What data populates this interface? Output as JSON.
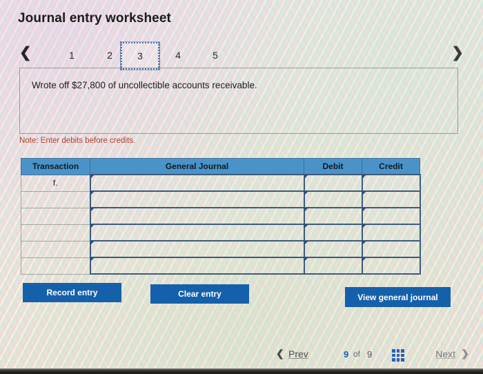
{
  "page_title": "Journal entry worksheet",
  "tabs": {
    "prev_icon": "chevron-left-icon",
    "next_icon": "chevron-right-icon",
    "items": [
      {
        "label": "1",
        "selected": false
      },
      {
        "label": "2",
        "selected": false
      },
      {
        "label": "3",
        "selected": true
      },
      {
        "label": "4",
        "selected": false
      },
      {
        "label": "5",
        "selected": false
      }
    ]
  },
  "description": "Wrote off $27,800 of uncollectible accounts receivable.",
  "note": "Note: Enter debits before credits.",
  "table": {
    "headers": {
      "transaction": "Transaction",
      "general_journal": "General Journal",
      "debit": "Debit",
      "credit": "Credit"
    },
    "rows": [
      {
        "transaction": "f.",
        "general_journal": "",
        "debit": "",
        "credit": ""
      },
      {
        "transaction": "",
        "general_journal": "",
        "debit": "",
        "credit": ""
      },
      {
        "transaction": "",
        "general_journal": "",
        "debit": "",
        "credit": ""
      },
      {
        "transaction": "",
        "general_journal": "",
        "debit": "",
        "credit": ""
      },
      {
        "transaction": "",
        "general_journal": "",
        "debit": "",
        "credit": ""
      },
      {
        "transaction": "",
        "general_journal": "",
        "debit": "",
        "credit": ""
      }
    ]
  },
  "buttons": {
    "record": "Record entry",
    "clear": "Clear entry",
    "view_journal": "View general journal"
  },
  "pagination": {
    "prev_label": "Prev",
    "next_label": "Next",
    "current": "9",
    "of": "of",
    "total": "9",
    "grid_icon": "grid-view-icon",
    "prev_icon": "chevron-left-icon",
    "next_icon": "chevron-right-icon"
  },
  "colors": {
    "header_blue": "#4a93c8",
    "button_blue": "#1560ab",
    "note_red": "#b4402a",
    "cell_border": "#3c5a7c",
    "accent_blue": "#1c5fae"
  }
}
